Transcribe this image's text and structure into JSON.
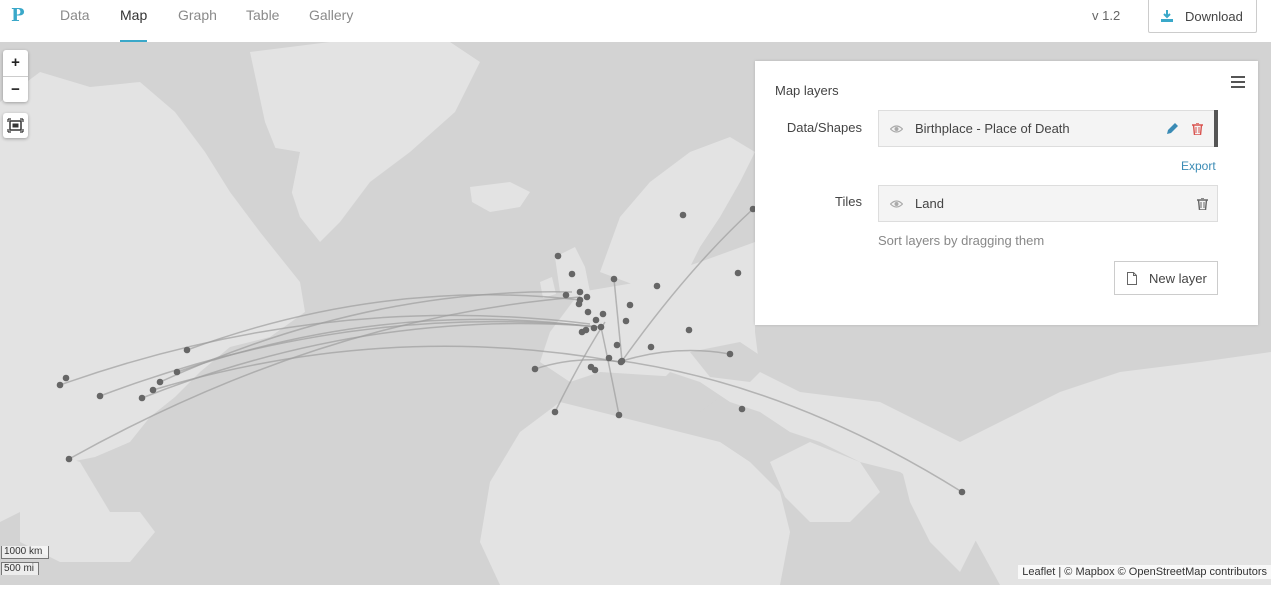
{
  "app": {
    "logo": "P",
    "tabs": [
      {
        "label": "Data",
        "active": false
      },
      {
        "label": "Map",
        "active": true
      },
      {
        "label": "Graph",
        "active": false
      },
      {
        "label": "Table",
        "active": false
      },
      {
        "label": "Gallery",
        "active": false
      }
    ],
    "version": "v 1.2",
    "download_label": "Download",
    "accent_color": "#3aa8c9"
  },
  "map": {
    "zoom_in": "+",
    "zoom_out": "−",
    "scale_km": "1000 km",
    "scale_mi": "500 mi",
    "attribution": "Leaflet | © Mapbox © OpenStreetMap contributors"
  },
  "layers_panel": {
    "title": "Map layers",
    "data_label": "Data/Shapes",
    "data_layer": {
      "name": "Birthplace - Place of Death",
      "icons": [
        "eye-icon",
        "pencil-icon",
        "trash-icon"
      ]
    },
    "export_label": "Export",
    "tiles_label": "Tiles",
    "tiles_layer": {
      "name": "Land",
      "icons": [
        "eye-icon",
        "trash-icon"
      ]
    },
    "sort_hint": "Sort layers by dragging them",
    "new_layer_label": "New layer"
  }
}
